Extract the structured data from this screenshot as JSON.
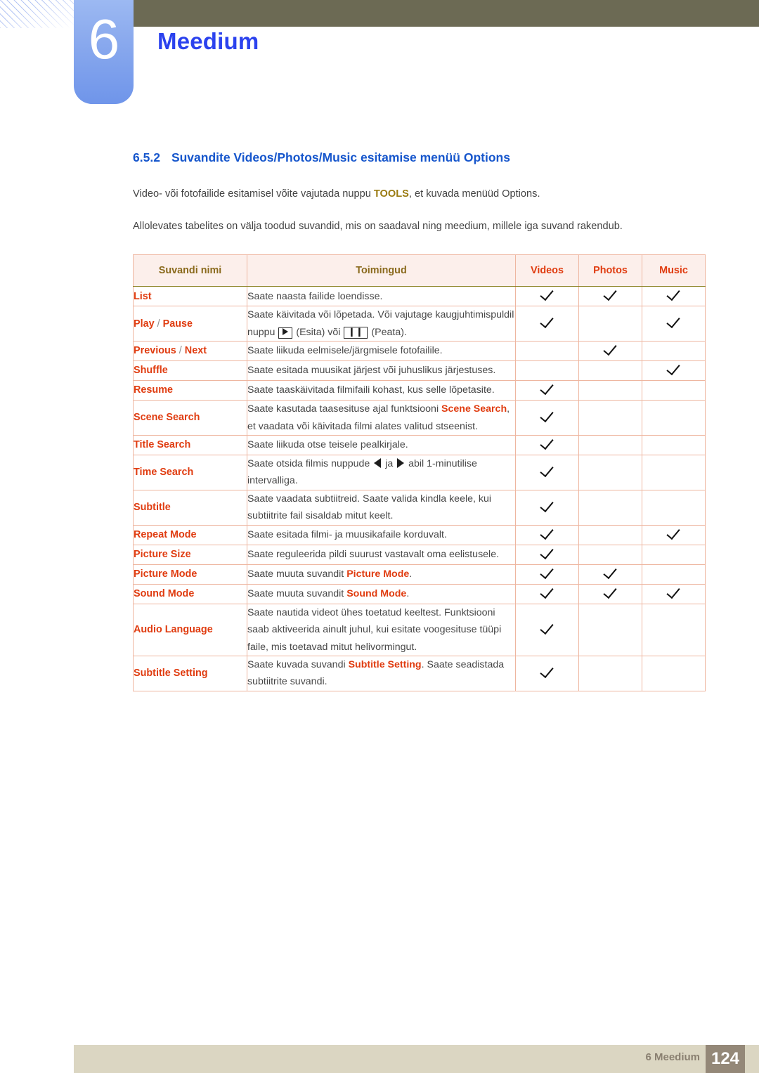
{
  "header": {
    "chapter_number": "6",
    "chapter_title": "Meedium"
  },
  "section": {
    "number": "6.5.2",
    "title": "Suvandite Videos/Photos/Music esitamise menüü Options"
  },
  "paragraphs": {
    "p1_before": "Video- või fotofailide esitamisel võite vajutada nuppu ",
    "p1_tools": "TOOLS",
    "p1_after": ", et kuvada menüüd Options.",
    "p2": "Allolevates tabelites on välja toodud suvandid, mis on saadaval ning meedium, millele iga suvand rakendub."
  },
  "table": {
    "headers": {
      "name": "Suvandi nimi",
      "action": "Toimingud",
      "videos": "Videos",
      "photos": "Photos",
      "music": "Music"
    },
    "rows": [
      {
        "name": "List",
        "desc": "Saate naasta failide loendisse.",
        "videos": true,
        "photos": true,
        "music": true
      },
      {
        "name": "Play",
        "name_sep": " / ",
        "name2": "Pause",
        "desc_1": "Saate käivitada või lõpetada. Või vajutage kaugjuhtimispuldil nuppu ",
        "desc_2": " (Esita) või ",
        "desc_3": " (Peata).",
        "videos": true,
        "photos": false,
        "music": true
      },
      {
        "name": "Previous",
        "name_sep": " / ",
        "name2": "Next",
        "desc": "Saate liikuda eelmisele/järgmisele fotofailile.",
        "videos": false,
        "photos": true,
        "music": false
      },
      {
        "name": "Shuffle",
        "desc": "Saate esitada muusikat järjest või juhuslikus järjestuses.",
        "videos": false,
        "photos": false,
        "music": true
      },
      {
        "name": "Resume",
        "desc": "Saate taaskäivitada filmifaili kohast, kus selle lõpetasite.",
        "videos": true,
        "photos": false,
        "music": false
      },
      {
        "name": "Scene Search",
        "desc_1": "Saate kasutada taasesituse ajal funktsiooni ",
        "desc_hl": "Scene Search",
        "desc_2": ", et vaadata või käivitada filmi alates valitud stseenist.",
        "videos": true,
        "photos": false,
        "music": false
      },
      {
        "name": "Title Search",
        "desc": "Saate liikuda otse teisele pealkirjale.",
        "videos": true,
        "photos": false,
        "music": false
      },
      {
        "name": "Time Search",
        "desc_1": "Saate otsida filmis nuppude ",
        "desc_2": " ja ",
        "desc_3": " abil 1-minutilise intervalliga.",
        "videos": true,
        "photos": false,
        "music": false
      },
      {
        "name": "Subtitle",
        "desc": "Saate vaadata subtiitreid. Saate valida kindla keele, kui subtiitrite fail sisaldab mitut keelt.",
        "videos": true,
        "photos": false,
        "music": false
      },
      {
        "name": "Repeat Mode",
        "desc": "Saate esitada filmi- ja muusikafaile korduvalt.",
        "videos": true,
        "photos": false,
        "music": true
      },
      {
        "name": "Picture Size",
        "desc": "Saate reguleerida pildi suurust vastavalt oma eelistusele.",
        "videos": true,
        "photos": false,
        "music": false
      },
      {
        "name": "Picture Mode",
        "desc_1": "Saate muuta suvandit ",
        "desc_hl": "Picture Mode",
        "desc_2": ".",
        "videos": true,
        "photos": true,
        "music": false
      },
      {
        "name": "Sound Mode",
        "desc_1": "Saate muuta suvandit ",
        "desc_hl": "Sound Mode",
        "desc_2": ".",
        "videos": true,
        "photos": true,
        "music": true
      },
      {
        "name": "Audio Language",
        "desc": "Saate nautida videot ühes toetatud keeltest. Funktsiooni saab aktiveerida ainult juhul, kui esitate voogesituse tüüpi faile, mis toetavad mitut helivormingut.",
        "videos": true,
        "photos": false,
        "music": false
      },
      {
        "name": "Subtitle Setting",
        "desc_1": "Saate kuvada suvandi ",
        "desc_hl": "Subtitle Setting",
        "desc_2": ". Saate seadistada subtiitrite suvandi.",
        "videos": true,
        "photos": false,
        "music": false
      }
    ]
  },
  "footer": {
    "label": "6 Meedium",
    "page": "124"
  },
  "colors": {
    "topbar": "#6c6a54",
    "chapter_box": "#8cabee",
    "chapter_title": "#2b42ee",
    "section_heading": "#1656cc",
    "tools_highlight": "#9a7b12",
    "table_header_bg": "#fcefeb",
    "table_header_dark": "#8a6a1d",
    "table_header_red": "#e03c10",
    "row_name": "#e03c10",
    "body_text": "#434343",
    "footer_bar": "#dbd6c2",
    "footer_page_box": "#948878"
  }
}
